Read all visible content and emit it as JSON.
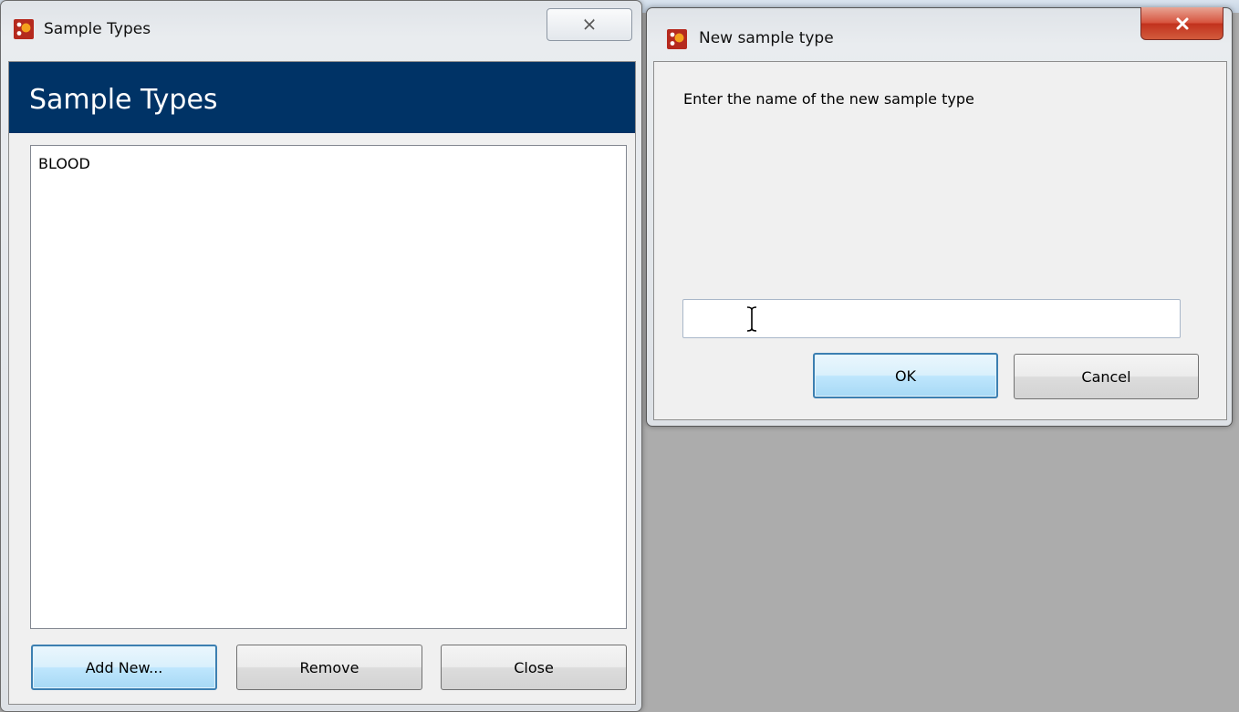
{
  "sample_types_window": {
    "title": "Sample Types",
    "header": "Sample Types",
    "items": [
      "BLOOD"
    ],
    "buttons": {
      "add_new": "Add New...",
      "remove": "Remove",
      "close": "Close"
    },
    "close_glyph": "⌧"
  },
  "new_type_dialog": {
    "title": "New sample type",
    "prompt": "Enter the name of the new sample type",
    "input_value": "",
    "buttons": {
      "ok": "OK",
      "cancel": "Cancel"
    },
    "close_glyph": "✕"
  },
  "colors": {
    "header_band": "#003366",
    "dialog_close": "#c2321d",
    "app_icon": "#b6281d"
  },
  "icons": {
    "app": "app-logo-icon",
    "close": "close-icon",
    "cursor": "text-cursor-icon"
  }
}
